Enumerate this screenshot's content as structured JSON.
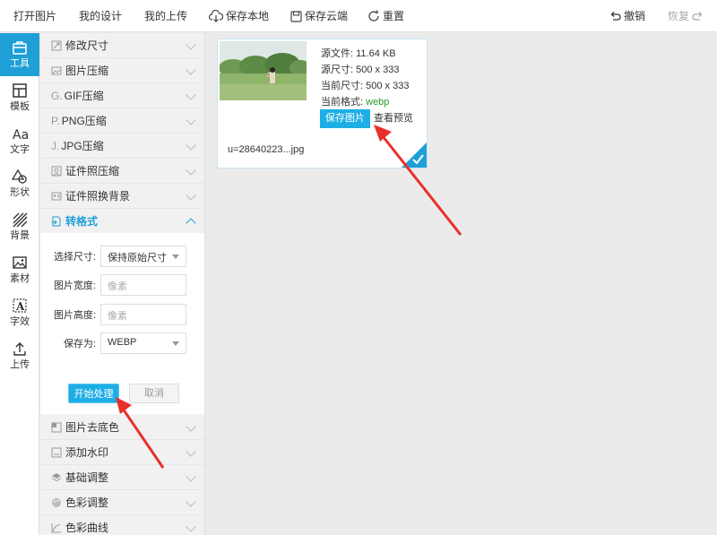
{
  "topbar": {
    "open_image": "打开图片",
    "my_designs": "我的设计",
    "my_uploads": "我的上传",
    "save_local": "保存本地",
    "save_cloud": "保存云端",
    "reset": "重置",
    "undo": "撤销",
    "redo": "恢复"
  },
  "leftnav": {
    "items": [
      {
        "label": "工具",
        "icon": "toolbox-icon"
      },
      {
        "label": "模板",
        "icon": "template-icon"
      },
      {
        "label": "文字",
        "icon": "text-icon"
      },
      {
        "label": "形状",
        "icon": "shape-icon"
      },
      {
        "label": "背景",
        "icon": "background-icon"
      },
      {
        "label": "素材",
        "icon": "image-icon"
      },
      {
        "label": "字效",
        "icon": "text-effect-icon"
      },
      {
        "label": "上传",
        "icon": "upload-icon"
      }
    ]
  },
  "panel": {
    "sections": [
      {
        "label": "修改尺寸",
        "prefix": ""
      },
      {
        "label": "图片压缩",
        "prefix": ""
      },
      {
        "label": "GIF压缩",
        "prefix": "G."
      },
      {
        "label": "PNG压缩",
        "prefix": "P."
      },
      {
        "label": "JPG压缩",
        "prefix": "J."
      },
      {
        "label": "证件照压缩",
        "prefix": ""
      },
      {
        "label": "证件照换背景",
        "prefix": ""
      },
      {
        "label": "转格式",
        "prefix": ""
      }
    ],
    "sections_below": [
      {
        "label": "图片去底色"
      },
      {
        "label": "添加水印"
      },
      {
        "label": "基础调整"
      },
      {
        "label": "色彩调整"
      },
      {
        "label": "色彩曲线"
      }
    ],
    "form": {
      "size_label": "选择尺寸:",
      "size_value": "保持原始尺寸",
      "width_label": "图片宽度:",
      "width_placeholder": "像素",
      "height_label": "图片高度:",
      "height_placeholder": "像素",
      "saveas_label": "保存为:",
      "saveas_value": "WEBP",
      "start_button": "开始处理",
      "cancel_button": "取消"
    }
  },
  "card": {
    "source_file_label": "源文件:",
    "source_file_value": "11.64 KB",
    "source_size_label": "源尺寸:",
    "source_size_value": "500 x 333",
    "current_size_label": "当前尺寸:",
    "current_size_value": "500 x 333",
    "current_format_label": "当前格式:",
    "current_format_value": "webp",
    "save_button": "保存图片",
    "preview_link": "查看预览",
    "filename": "u=28640223...jpg"
  },
  "colors": {
    "accent": "#1e9fd6",
    "button": "#1eaee6",
    "arrow": "#e8302a",
    "format_green": "#2a9d2a"
  }
}
